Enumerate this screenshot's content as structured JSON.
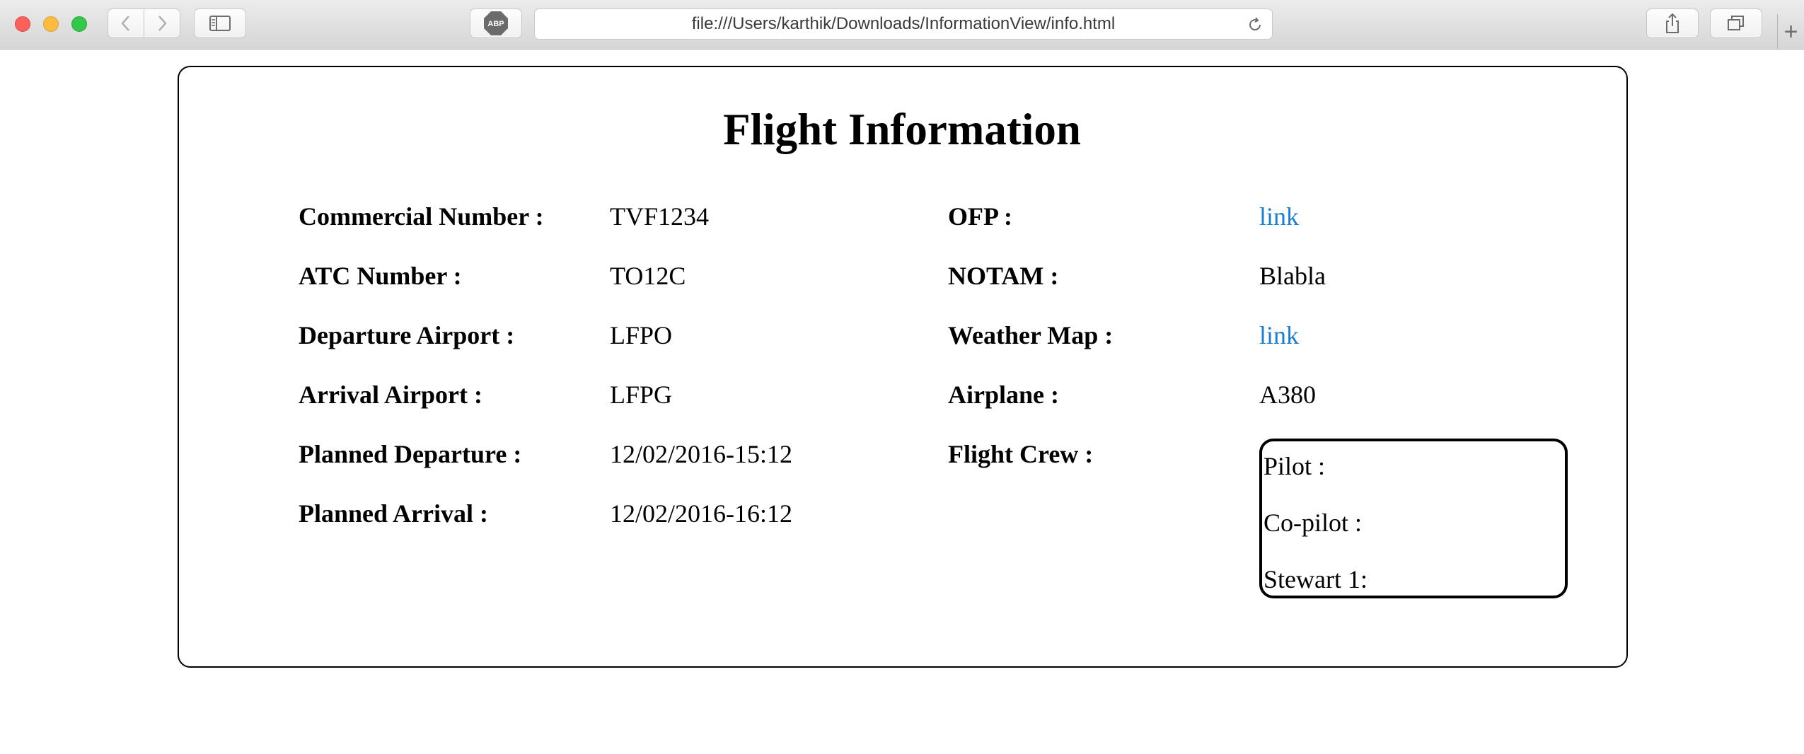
{
  "browser": {
    "url": "file:///Users/karthik/Downloads/InformationView/info.html",
    "icons": [
      "back-icon",
      "forward-icon",
      "sidebar-icon",
      "adblock-icon",
      "reload-icon",
      "share-icon",
      "tabs-icon",
      "plus-icon"
    ],
    "abp_label": "ABP",
    "new_tab_label": "+"
  },
  "page": {
    "title": "Flight Information",
    "left_fields": [
      {
        "label": "Commercial Number :",
        "value": "TVF1234"
      },
      {
        "label": "ATC Number :",
        "value": "TO12C"
      },
      {
        "label": "Departure Airport :",
        "value": "LFPO"
      },
      {
        "label": "Arrival Airport :",
        "value": "LFPG"
      },
      {
        "label": "Planned Departure :",
        "value": "12/02/2016-15:12"
      },
      {
        "label": "Planned Arrival :",
        "value": "12/02/2016-16:12"
      }
    ],
    "right_fields": [
      {
        "label": "OFP :",
        "value": "link"
      },
      {
        "label": "NOTAM :",
        "value": "Blabla"
      },
      {
        "label": "Weather Map :",
        "value": "link"
      },
      {
        "label": "Airplane :",
        "value": "A380"
      },
      {
        "label": "Flight Crew :"
      }
    ],
    "crew": [
      "Pilot :",
      "Co-pilot :",
      "Stewart 1:"
    ],
    "colors": {
      "link": "#1a7fd4",
      "text": "#000000",
      "border": "#000000"
    }
  }
}
